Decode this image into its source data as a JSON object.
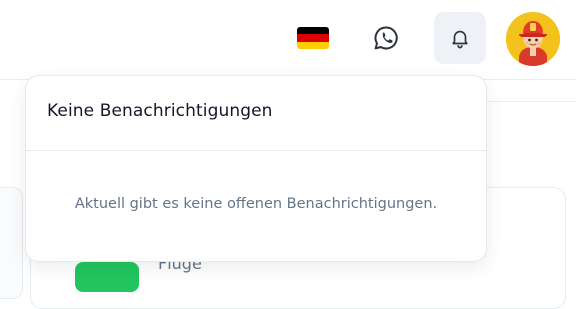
{
  "header": {
    "language_flag": "german-flag-icon",
    "flag_colors": [
      "#000000",
      "#dd0000",
      "#ffce00"
    ],
    "whatsapp_icon": "whatsapp-icon",
    "notifications_icon": "bell-icon",
    "avatar_icon": "firefighter-avatar"
  },
  "notifications": {
    "title": "Keine Benachrichtigungen",
    "empty_message": "Aktuell gibt es keine offenen Benachrichtigungen."
  },
  "background": {
    "partial_text": "Flüge",
    "accent_color": "#22c55e"
  }
}
